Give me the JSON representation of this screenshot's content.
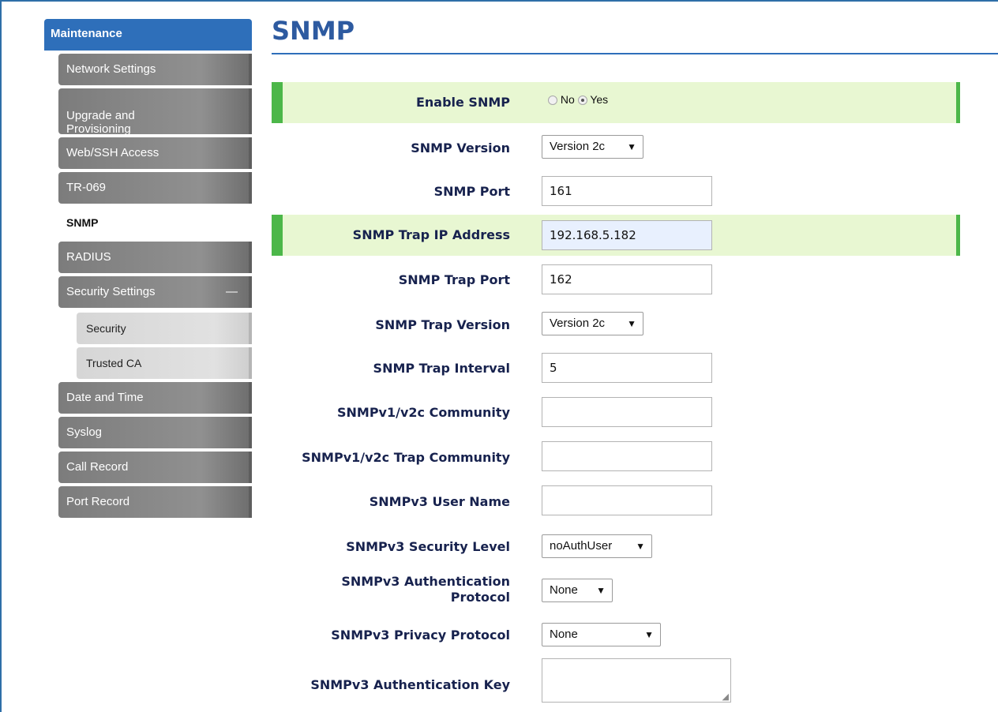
{
  "sidebar": {
    "header": "Maintenance",
    "items": {
      "network": "Network Settings",
      "upgrade": "Upgrade and\nProvisioning",
      "web_ssh": "Web/SSH Access",
      "tr069": "TR-069",
      "snmp": "SNMP",
      "radius": "RADIUS",
      "security_settings": "Security Settings",
      "security_settings_toggle": "—",
      "security": "Security",
      "trusted_ca": "Trusted CA",
      "date_time": "Date and Time",
      "syslog": "Syslog",
      "call_record": "Call Record",
      "port_record": "Port Record"
    }
  },
  "main": {
    "title": "SNMP",
    "fields": {
      "enable_snmp": {
        "label": "Enable SNMP",
        "opt_no": "No",
        "opt_yes": "Yes",
        "selected": "Yes"
      },
      "snmp_version": {
        "label": "SNMP Version",
        "value": "Version 2c"
      },
      "snmp_port": {
        "label": "SNMP Port",
        "value": "161"
      },
      "trap_ip": {
        "label": "SNMP Trap IP Address",
        "value": "192.168.5.182"
      },
      "trap_port": {
        "label": "SNMP Trap Port",
        "value": "162"
      },
      "trap_version": {
        "label": "SNMP Trap Version",
        "value": "Version 2c"
      },
      "trap_interval": {
        "label": "SNMP Trap Interval",
        "value": "5"
      },
      "community": {
        "label": "SNMPv1/v2c Community",
        "value": ""
      },
      "trap_community": {
        "label": "SNMPv1/v2c Trap Community",
        "value": ""
      },
      "v3_user": {
        "label": "SNMPv3 User Name",
        "value": ""
      },
      "v3_security_level": {
        "label": "SNMPv3 Security Level",
        "value": "noAuthUser"
      },
      "v3_auth_protocol": {
        "label_line1": "SNMPv3 Authentication",
        "label_line2": "Protocol",
        "value": "None"
      },
      "v3_privacy_protocol": {
        "label": "SNMPv3 Privacy Protocol",
        "value": "None"
      },
      "v3_auth_key": {
        "label": "SNMPv3 Authentication Key",
        "value": ""
      }
    }
  },
  "colors": {
    "accent_blue": "#2e6fba",
    "highlight_green": "#4cb749",
    "highlight_bg": "#e8f7d2",
    "label_navy": "#17224e"
  }
}
